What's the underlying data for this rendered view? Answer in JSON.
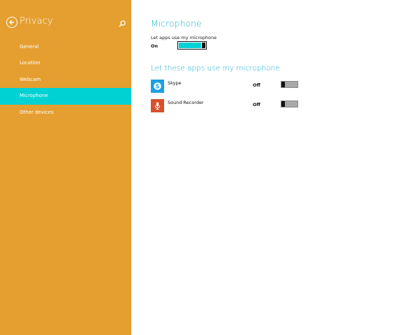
{
  "sidebar": {
    "title": "Privacy",
    "items": [
      {
        "label": "General",
        "selected": false
      },
      {
        "label": "Location",
        "selected": false
      },
      {
        "label": "Webcam",
        "selected": false
      },
      {
        "label": "Microphone",
        "selected": true
      },
      {
        "label": "Other devices",
        "selected": false
      }
    ]
  },
  "main": {
    "title": "Microphone",
    "setting": {
      "label": "Let apps use my microphone",
      "state": "On"
    },
    "apps_title": "Let these apps use my microphone",
    "apps": [
      {
        "name": "Skype",
        "state": "Off",
        "icon": "skype-icon",
        "color": "#1ba0e1"
      },
      {
        "name": "Sound Recorder",
        "state": "Off",
        "icon": "microphone-icon",
        "color": "#d9502a"
      }
    ]
  },
  "colors": {
    "sidebar_bg": "#e59f30",
    "accent": "#00d2d3",
    "title": "#1fb3c9"
  }
}
